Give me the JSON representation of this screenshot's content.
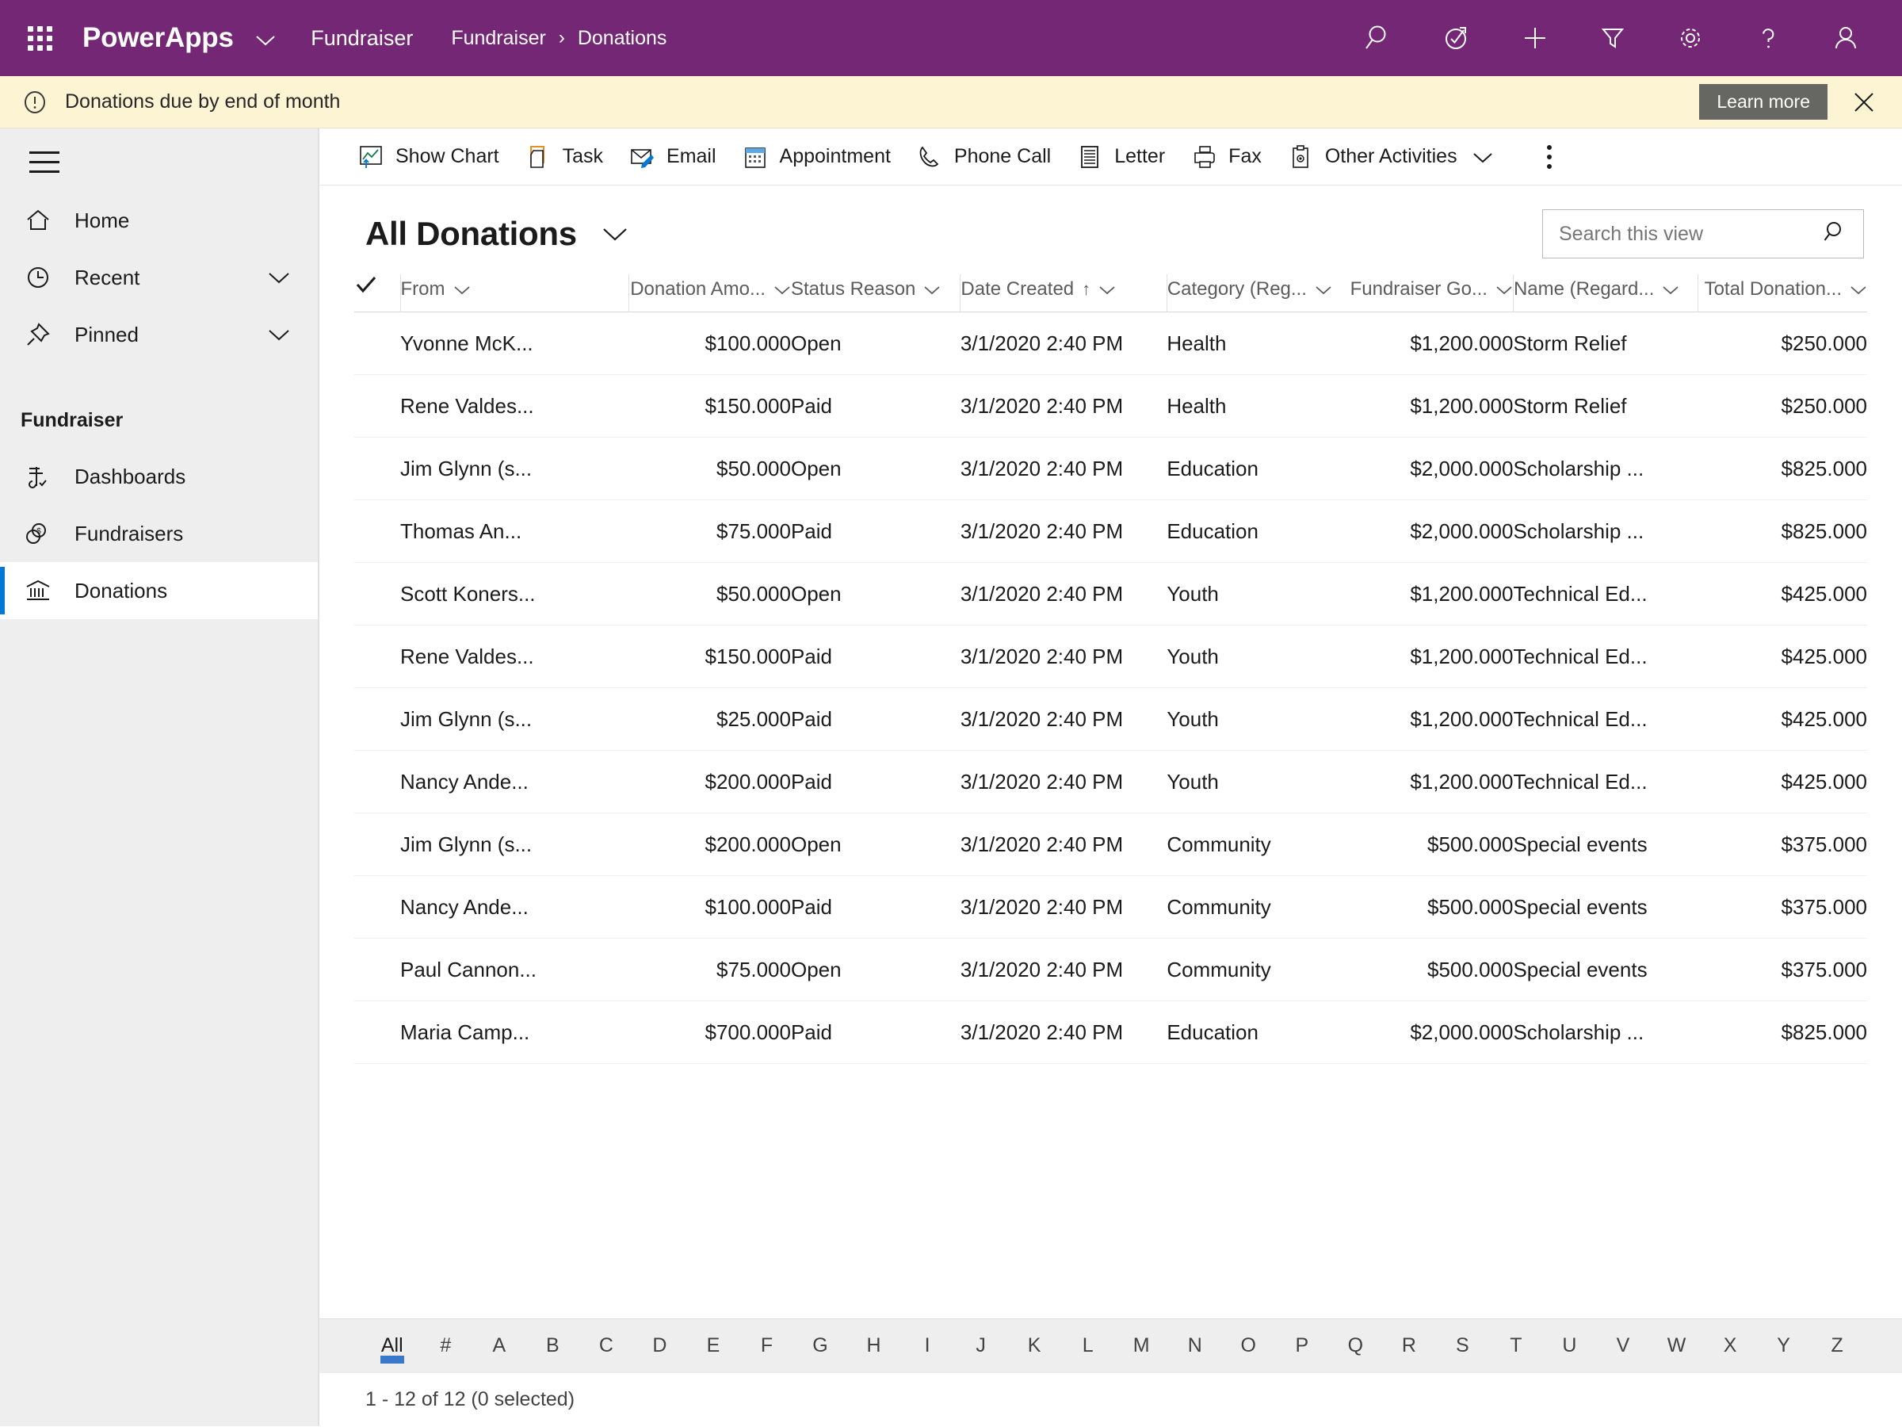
{
  "appbar": {
    "waffle_label": "App launcher",
    "brand": "PowerApps",
    "app_name": "Fundraiser",
    "breadcrumb": [
      "Fundraiser",
      "Donations"
    ],
    "breadcrumb_separator": "›",
    "accent_color": "#742774",
    "icons": [
      {
        "name": "search-icon",
        "label": "Search"
      },
      {
        "name": "assistant-icon",
        "label": "Assistant"
      },
      {
        "name": "quick-create-icon",
        "label": "Quick create"
      },
      {
        "name": "filter-icon",
        "label": "Filter"
      },
      {
        "name": "settings-gear-icon",
        "label": "Settings"
      },
      {
        "name": "help-icon",
        "label": "Help"
      },
      {
        "name": "user-profile-icon",
        "label": "Profile"
      }
    ]
  },
  "notification": {
    "message": "Donations due by end of month",
    "action_label": "Learn more",
    "background": "#fdf4d4",
    "button_color": "#666663"
  },
  "sidebar": {
    "group_title": "Fundraiser",
    "items": [
      {
        "label": "Home",
        "icon": "home-icon",
        "chevron": false,
        "selected": false
      },
      {
        "label": "Recent",
        "icon": "clock-icon",
        "chevron": true,
        "selected": false
      },
      {
        "label": "Pinned",
        "icon": "pin-icon",
        "chevron": true,
        "selected": false
      }
    ],
    "group_items": [
      {
        "label": "Dashboards",
        "icon": "dashboard-icon",
        "selected": false
      },
      {
        "label": "Fundraisers",
        "icon": "money-icon",
        "selected": false
      },
      {
        "label": "Donations",
        "icon": "bank-icon",
        "selected": true
      }
    ],
    "selected_indicator_color": "#0078d4"
  },
  "commandbar": {
    "commands": [
      {
        "label": "Show Chart",
        "icon": "show-chart-icon",
        "caret": false
      },
      {
        "label": "Task",
        "icon": "task-icon",
        "caret": false
      },
      {
        "label": "Email",
        "icon": "email-icon",
        "caret": false
      },
      {
        "label": "Appointment",
        "icon": "appointment-icon",
        "caret": false
      },
      {
        "label": "Phone Call",
        "icon": "phone-call-icon",
        "caret": false
      },
      {
        "label": "Letter",
        "icon": "letter-icon",
        "caret": false
      },
      {
        "label": "Fax",
        "icon": "fax-icon",
        "caret": false
      },
      {
        "label": "Other Activities",
        "icon": "other-activities-icon",
        "caret": true
      }
    ],
    "overflow_label": "More commands"
  },
  "view": {
    "title": "All Donations",
    "search_placeholder": "Search this view",
    "search_value": ""
  },
  "grid": {
    "columns": [
      {
        "label": "From",
        "align": "left",
        "sorted": false,
        "width": "16%"
      },
      {
        "label": "Donation Amo...",
        "align": "right",
        "sorted": false,
        "width": "11%"
      },
      {
        "label": "Status Reason",
        "align": "left",
        "sorted": false,
        "width": "11.5%"
      },
      {
        "label": "Date Created",
        "align": "left",
        "sorted": true,
        "sort_dir": "↑",
        "width": "14%"
      },
      {
        "label": "Category (Reg...",
        "align": "left",
        "sorted": false,
        "width": "12%"
      },
      {
        "label": "Fundraiser Go...",
        "align": "right",
        "sorted": false,
        "width": "11.5%"
      },
      {
        "label": "Name (Regard...",
        "align": "left",
        "sorted": false,
        "width": "12.5%"
      },
      {
        "label": "Total Donation...",
        "align": "right",
        "sorted": false,
        "width": "11.5%"
      }
    ],
    "rows": [
      {
        "from": "Yvonne McK...",
        "amount": "$100.000",
        "status": "Open",
        "date": "3/1/2020 2:40 PM",
        "category": "Health",
        "goal": "$1,200.000",
        "name": "Storm Relief",
        "total": "$250.000"
      },
      {
        "from": "Rene Valdes...",
        "amount": "$150.000",
        "status": "Paid",
        "date": "3/1/2020 2:40 PM",
        "category": "Health",
        "goal": "$1,200.000",
        "name": "Storm Relief",
        "total": "$250.000"
      },
      {
        "from": "Jim Glynn (s...",
        "amount": "$50.000",
        "status": "Open",
        "date": "3/1/2020 2:40 PM",
        "category": "Education",
        "goal": "$2,000.000",
        "name": "Scholarship ...",
        "total": "$825.000"
      },
      {
        "from": "Thomas An...",
        "amount": "$75.000",
        "status": "Paid",
        "date": "3/1/2020 2:40 PM",
        "category": "Education",
        "goal": "$2,000.000",
        "name": "Scholarship ...",
        "total": "$825.000"
      },
      {
        "from": "Scott Koners...",
        "amount": "$50.000",
        "status": "Open",
        "date": "3/1/2020 2:40 PM",
        "category": "Youth",
        "goal": "$1,200.000",
        "name": "Technical Ed...",
        "total": "$425.000"
      },
      {
        "from": "Rene Valdes...",
        "amount": "$150.000",
        "status": "Paid",
        "date": "3/1/2020 2:40 PM",
        "category": "Youth",
        "goal": "$1,200.000",
        "name": "Technical Ed...",
        "total": "$425.000"
      },
      {
        "from": "Jim Glynn (s...",
        "amount": "$25.000",
        "status": "Paid",
        "date": "3/1/2020 2:40 PM",
        "category": "Youth",
        "goal": "$1,200.000",
        "name": "Technical Ed...",
        "total": "$425.000"
      },
      {
        "from": "Nancy Ande...",
        "amount": "$200.000",
        "status": "Paid",
        "date": "3/1/2020 2:40 PM",
        "category": "Youth",
        "goal": "$1,200.000",
        "name": "Technical Ed...",
        "total": "$425.000"
      },
      {
        "from": "Jim Glynn (s...",
        "amount": "$200.000",
        "status": "Open",
        "date": "3/1/2020 2:40 PM",
        "category": "Community",
        "goal": "$500.000",
        "name": "Special events",
        "total": "$375.000"
      },
      {
        "from": "Nancy Ande...",
        "amount": "$100.000",
        "status": "Paid",
        "date": "3/1/2020 2:40 PM",
        "category": "Community",
        "goal": "$500.000",
        "name": "Special events",
        "total": "$375.000"
      },
      {
        "from": "Paul Cannon...",
        "amount": "$75.000",
        "status": "Open",
        "date": "3/1/2020 2:40 PM",
        "category": "Community",
        "goal": "$500.000",
        "name": "Special events",
        "total": "$375.000"
      },
      {
        "from": "Maria Camp...",
        "amount": "$700.000",
        "status": "Paid",
        "date": "3/1/2020 2:40 PM",
        "category": "Education",
        "goal": "$2,000.000",
        "name": "Scholarship ...",
        "total": "$825.000"
      }
    ]
  },
  "alphabet": {
    "active": "All",
    "letters": [
      "All",
      "#",
      "A",
      "B",
      "C",
      "D",
      "E",
      "F",
      "G",
      "H",
      "I",
      "J",
      "K",
      "L",
      "M",
      "N",
      "O",
      "P",
      "Q",
      "R",
      "S",
      "T",
      "U",
      "V",
      "W",
      "X",
      "Y",
      "Z"
    ],
    "indicator_color": "#3a78c9"
  },
  "status": {
    "text": "1 - 12 of 12 (0 selected)"
  }
}
